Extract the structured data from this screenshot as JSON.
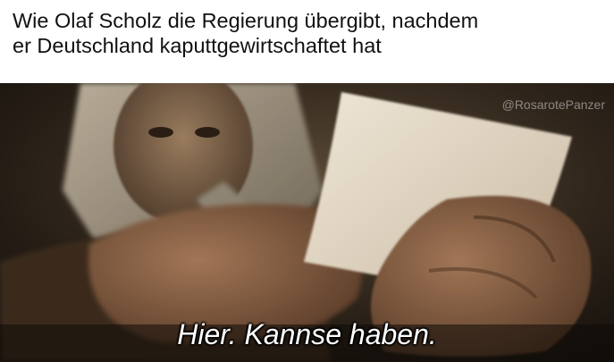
{
  "caption": {
    "line1": "Wie Olaf Scholz die Regierung übergibt, nachdem",
    "line2": "er Deutschland kaputtgewirtschaftet hat"
  },
  "frame": {
    "watermark": "@RosarotePanzer",
    "subtitle": "Hier. Kannse haben."
  }
}
